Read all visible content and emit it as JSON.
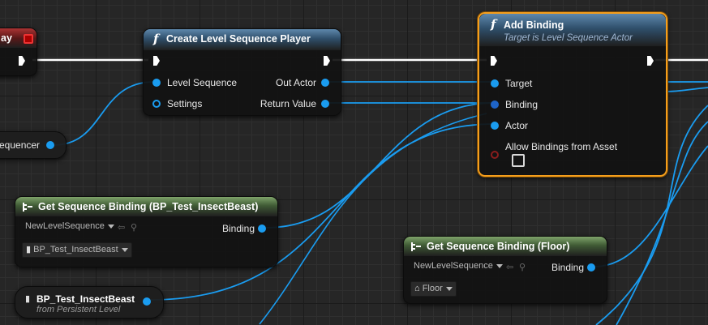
{
  "colors": {
    "pin_object": "#1a9cf0",
    "exec": "#ffffff",
    "selection": "#f59e1b",
    "pin_bool": "#8a1d1d"
  },
  "event_node": {
    "title_fragment": "ay"
  },
  "create_player": {
    "title": "Create Level Sequence Player",
    "inputs": [
      "Level Sequence",
      "Settings"
    ],
    "outputs": [
      "Out Actor",
      "Return Value"
    ]
  },
  "add_binding": {
    "title": "Add Binding",
    "subtitle": "Target is Level Sequence Actor",
    "inputs": [
      "Target",
      "Binding",
      "Actor",
      "Allow Bindings from Asset"
    ]
  },
  "sequencer_var": {
    "label": "equencer"
  },
  "get_binding_insect": {
    "title": "Get Sequence Binding (BP_Test_InsectBeast)",
    "sequence_value": "NewLevelSequence",
    "actor_value": "BP_Test_InsectBeast",
    "output": "Binding"
  },
  "get_binding_floor": {
    "title": "Get Sequence Binding (Floor)",
    "sequence_value": "NewLevelSequence",
    "actor_value": "Floor",
    "output": "Binding"
  },
  "insect_ref": {
    "title": "BP_Test_InsectBeast",
    "subtitle": "from Persistent Level"
  },
  "icons": {
    "function": "function-icon",
    "struct": "struct-arrow-icon",
    "actor": "actor-icon",
    "floor": "house-icon",
    "browse": "browse-icon",
    "search": "search-icon"
  }
}
